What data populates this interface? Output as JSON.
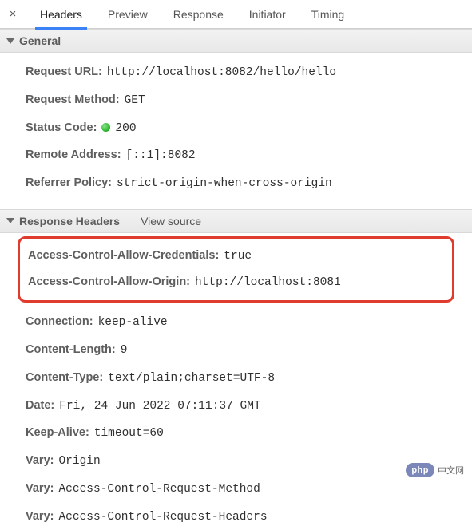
{
  "tabs": {
    "headers": "Headers",
    "preview": "Preview",
    "response": "Response",
    "initiator": "Initiator",
    "timing": "Timing"
  },
  "close_glyph": "×",
  "sections": {
    "general": "General",
    "response_headers": "Response Headers",
    "view_source": "View source"
  },
  "general": {
    "request_url_label": "Request URL:",
    "request_url_value": "http://localhost:8082/hello/hello",
    "request_method_label": "Request Method:",
    "request_method_value": "GET",
    "status_code_label": "Status Code:",
    "status_code_value": "200",
    "remote_address_label": "Remote Address:",
    "remote_address_value": "[::1]:8082",
    "referrer_policy_label": "Referrer Policy:",
    "referrer_policy_value": "strict-origin-when-cross-origin"
  },
  "response_headers": {
    "acac_label": "Access-Control-Allow-Credentials:",
    "acac_value": "true",
    "acao_label": "Access-Control-Allow-Origin:",
    "acao_value": "http://localhost:8081",
    "connection_label": "Connection:",
    "connection_value": "keep-alive",
    "content_length_label": "Content-Length:",
    "content_length_value": "9",
    "content_type_label": "Content-Type:",
    "content_type_value": "text/plain;charset=UTF-8",
    "date_label": "Date:",
    "date_value": "Fri, 24 Jun 2022 07:11:37 GMT",
    "keep_alive_label": "Keep-Alive:",
    "keep_alive_value": "timeout=60",
    "vary1_label": "Vary:",
    "vary1_value": "Origin",
    "vary2_label": "Vary:",
    "vary2_value": "Access-Control-Request-Method",
    "vary3_label": "Vary:",
    "vary3_value": "Access-Control-Request-Headers"
  },
  "watermark": {
    "badge": "php",
    "suffix": "中文网"
  }
}
